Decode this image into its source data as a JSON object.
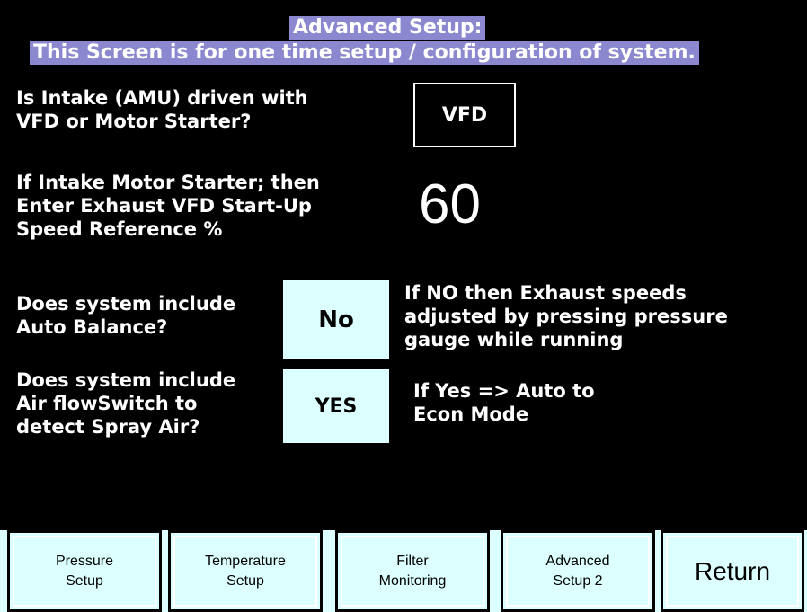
{
  "header": {
    "title": "Advanced Setup:",
    "subtitle": "This Screen is for one time setup / configuration  of system."
  },
  "intake": {
    "question": "Is Intake (AMU) driven with\nVFD or Motor Starter?",
    "value": "VFD"
  },
  "startup_speed": {
    "question": "If Intake Motor Starter;  then\nEnter Exhaust VFD Start-Up\nSpeed Reference %",
    "value": "60"
  },
  "auto_balance": {
    "question": "Does system include\nAuto Balance?",
    "value": "No",
    "note": "If NO then Exhaust speeds\nadjusted by pressing pressure\ngauge while running"
  },
  "air_flow_switch": {
    "question": "Does system include\nAir flowSwitch to\ndetect Spray Air?",
    "value": "YES",
    "note": "If Yes => Auto to\nEcon Mode"
  },
  "nav": {
    "pressure": "Pressure\nSetup",
    "temperature": "Temperature\nSetup",
    "filter": "Filter\nMonitoring",
    "advanced2": "Advanced\nSetup 2",
    "return": "Return"
  },
  "colors": {
    "background": "#000000",
    "header_band": "#8c88cf",
    "button_fill": "#dcffff"
  }
}
